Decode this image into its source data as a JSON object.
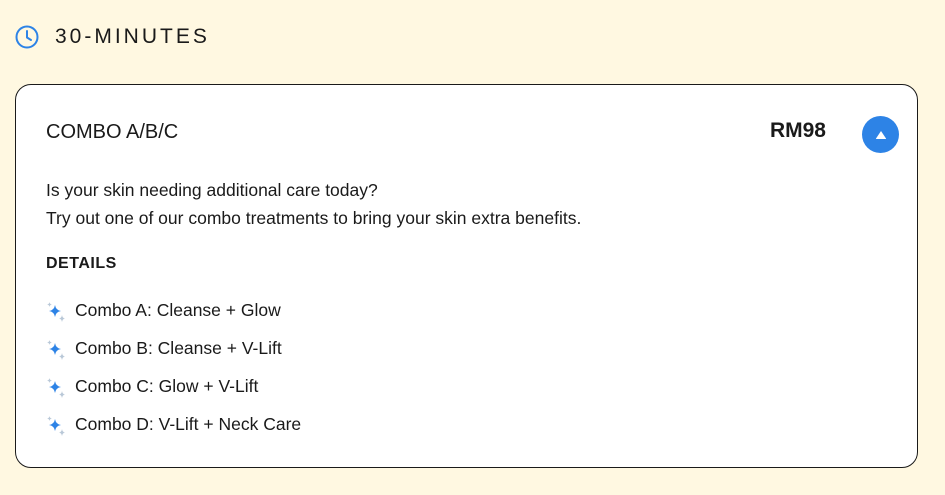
{
  "section": {
    "title": "30-MINUTES",
    "icon": "clock-icon"
  },
  "card": {
    "title": "COMBO A/B/C",
    "price": "RM98",
    "toggle_icon": "chevron-up-icon",
    "description": [
      "Is your skin needing additional care today?",
      "Try out one of our combo treatments to bring your skin extra benefits."
    ],
    "details_heading": "DETAILS",
    "details": [
      "Combo A: Cleanse + Glow",
      "Combo B: Cleanse + V-Lift",
      "Combo C: Glow + V-Lift",
      "Combo D: V-Lift + Neck Care"
    ],
    "details_icon": "sparkle-icon"
  },
  "colors": {
    "page_background": "#fff8e1",
    "accent_blue": "#2d83e6",
    "card_border": "#1a1a1a",
    "text": "#1a1a1a"
  }
}
